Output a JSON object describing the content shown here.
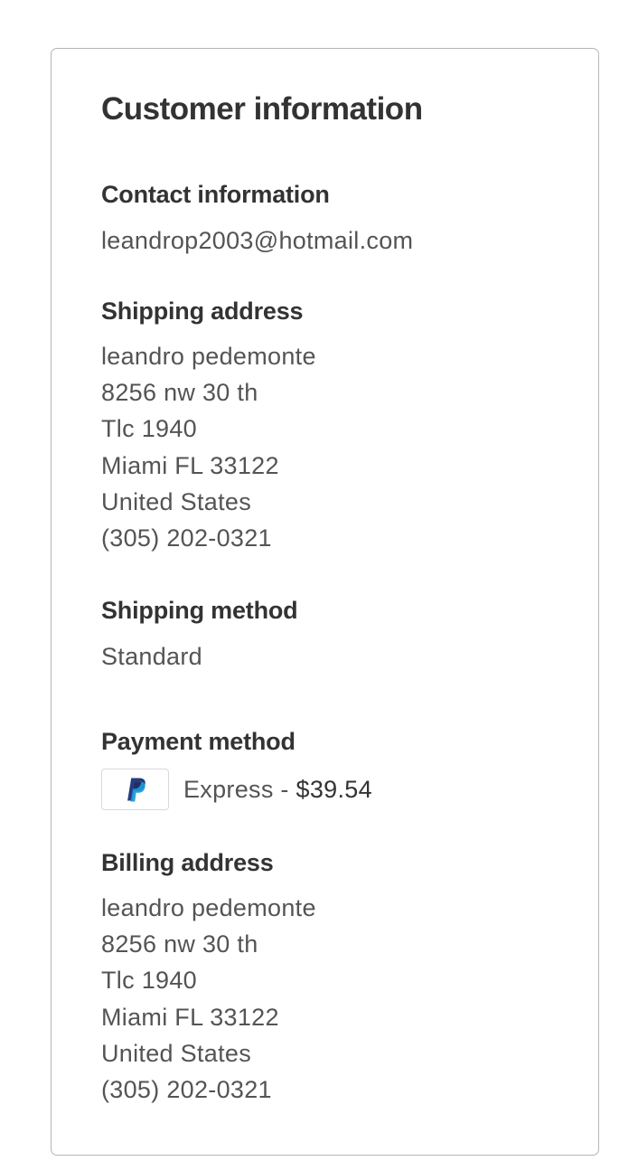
{
  "customer_information": {
    "title": "Customer information",
    "contact": {
      "heading": "Contact information",
      "email": "leandrop2003@hotmail.com"
    },
    "shipping_address": {
      "heading": "Shipping address",
      "lines": [
        "leandro pedemonte",
        "8256 nw 30 th",
        "Tlc 1940",
        "Miami FL 33122",
        "United States",
        "(305) 202-0321"
      ]
    },
    "shipping_method": {
      "heading": "Shipping method",
      "value": "Standard"
    },
    "payment_method": {
      "heading": "Payment method",
      "icon": "paypal-icon",
      "label_prefix": "Express - ",
      "amount": "$39.54",
      "colors": {
        "paypal_dark": "#253b80",
        "paypal_light": "#179bd7"
      }
    },
    "billing_address": {
      "heading": "Billing address",
      "lines": [
        "leandro pedemonte",
        "8256 nw 30 th",
        "Tlc 1940",
        "Miami FL 33122",
        "United States",
        "(305) 202-0321"
      ]
    }
  }
}
